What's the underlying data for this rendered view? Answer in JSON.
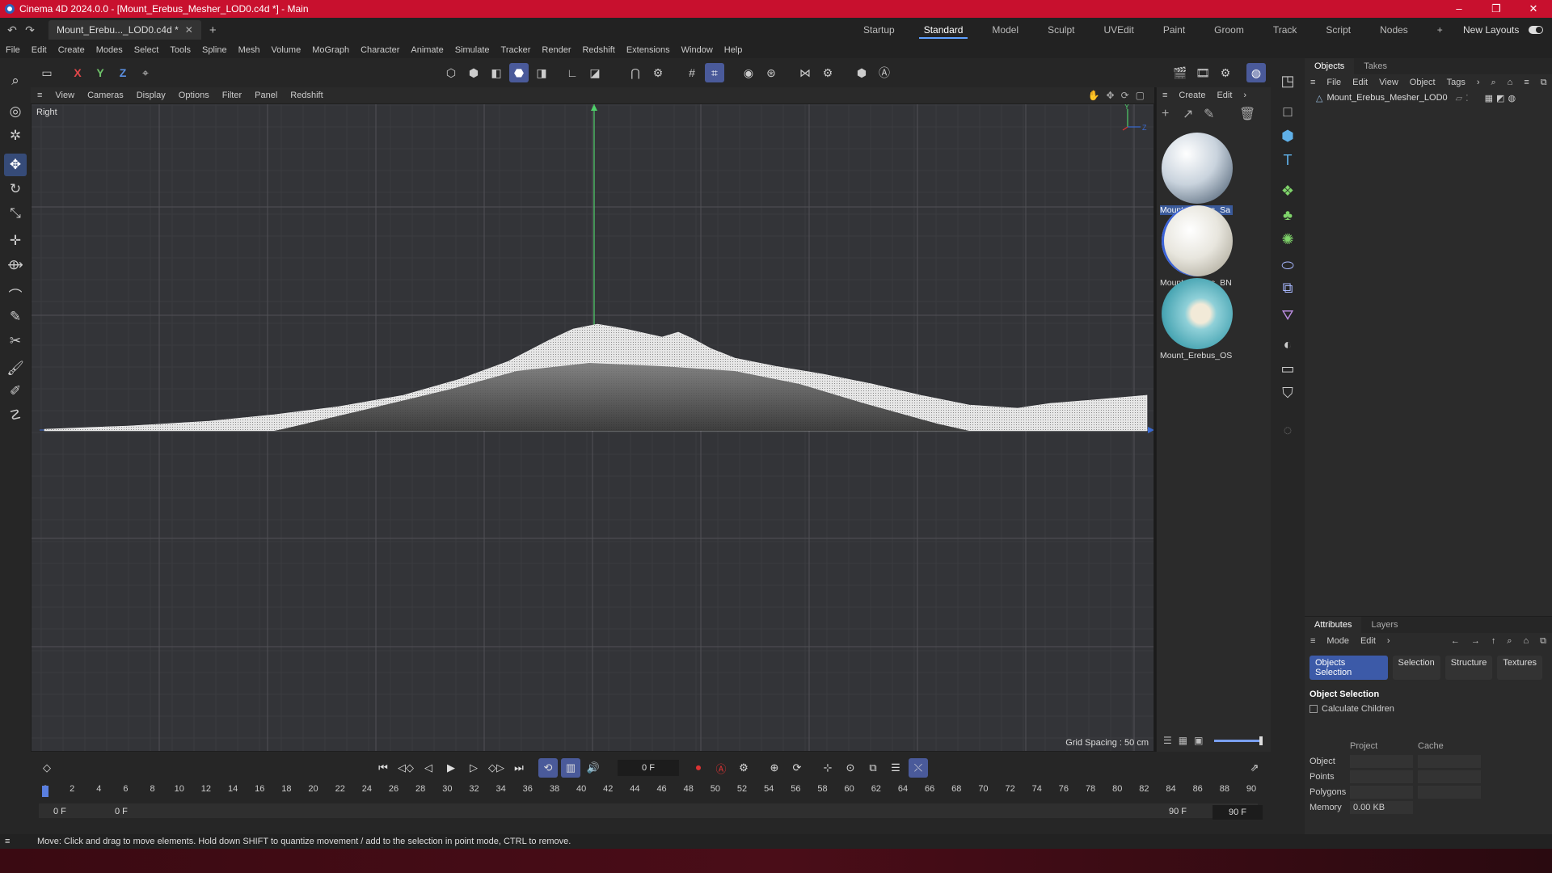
{
  "window": {
    "title": "Cinema 4D 2024.0.0 - [Mount_Erebus_Mesher_LOD0.c4d *] - Main",
    "minimize": "–",
    "maximize": "❐",
    "close": "✕"
  },
  "tabs": {
    "doc_tab": "Mount_Erebu..._LOD0.c4d *",
    "add": "+"
  },
  "layouts": {
    "items": [
      "Startup",
      "Standard",
      "Model",
      "Sculpt",
      "UVEdit",
      "Paint",
      "Groom",
      "Track",
      "Script",
      "Nodes"
    ],
    "active": "Standard",
    "add": "+",
    "new_layouts": "New Layouts"
  },
  "menu": [
    "File",
    "Edit",
    "Create",
    "Modes",
    "Select",
    "Tools",
    "Spline",
    "Mesh",
    "Volume",
    "MoGraph",
    "Character",
    "Animate",
    "Simulate",
    "Tracker",
    "Render",
    "Redshift",
    "Extensions",
    "Window",
    "Help"
  ],
  "toolbar": {
    "x": "X",
    "y": "Y",
    "z": "Z"
  },
  "viewport": {
    "menu": [
      "View",
      "Cameras",
      "Display",
      "Options",
      "Filter",
      "Panel",
      "Redshift"
    ],
    "label": "Right",
    "grid_spacing": "Grid Spacing : 50 cm",
    "axis_y": "Y",
    "axis_z": "Z"
  },
  "materials": {
    "menu": [
      "Create",
      "Edit"
    ],
    "items": [
      {
        "name": "Mount_Erebus_Sa",
        "selected": true
      },
      {
        "name": "Mount_Erebus_BN",
        "selected": false
      },
      {
        "name": "Mount_Erebus_OS",
        "selected": false
      }
    ]
  },
  "objects": {
    "tabs": [
      "Objects",
      "Takes"
    ],
    "menu": [
      "File",
      "Edit",
      "View",
      "Object",
      "Tags"
    ],
    "rows": [
      "Mount_Erebus_Mesher_LOD0"
    ]
  },
  "attributes": {
    "tabs": [
      "Attributes",
      "Layers"
    ],
    "menu": [
      "Mode",
      "Edit"
    ],
    "subtabs": [
      "Objects Selection",
      "Selection",
      "Structure",
      "Textures"
    ],
    "active_subtab": "Objects Selection",
    "heading": "Object Selection",
    "calc_children": "Calculate Children",
    "col_project": "Project",
    "col_cache": "Cache",
    "rows": [
      {
        "label": "Object",
        "project": "",
        "cache": ""
      },
      {
        "label": "Points",
        "project": "",
        "cache": ""
      },
      {
        "label": "Polygons",
        "project": "",
        "cache": ""
      },
      {
        "label": "Memory",
        "project": "0.00 KB",
        "cache": null
      }
    ]
  },
  "timeline": {
    "current_frame": "0 F",
    "ticks": [
      "0",
      "2",
      "4",
      "6",
      "8",
      "10",
      "12",
      "14",
      "16",
      "18",
      "20",
      "22",
      "24",
      "26",
      "28",
      "30",
      "32",
      "34",
      "36",
      "38",
      "40",
      "42",
      "44",
      "46",
      "48",
      "50",
      "52",
      "54",
      "56",
      "58",
      "60",
      "62",
      "64",
      "66",
      "68",
      "70",
      "72",
      "74",
      "76",
      "78",
      "80",
      "82",
      "84",
      "86",
      "88",
      "90"
    ],
    "range_start": "0 F",
    "range_start2": "0 F",
    "range_end": "90 F",
    "range_end2": "90 F"
  },
  "status": "Move: Click and drag to move elements. Hold down SHIFT to quantize movement / add to the selection in point mode, CTRL to remove.",
  "colors": {
    "title_bar": "#c8102e",
    "accent": "#5ea0ff",
    "active_tool": "#364b78"
  }
}
